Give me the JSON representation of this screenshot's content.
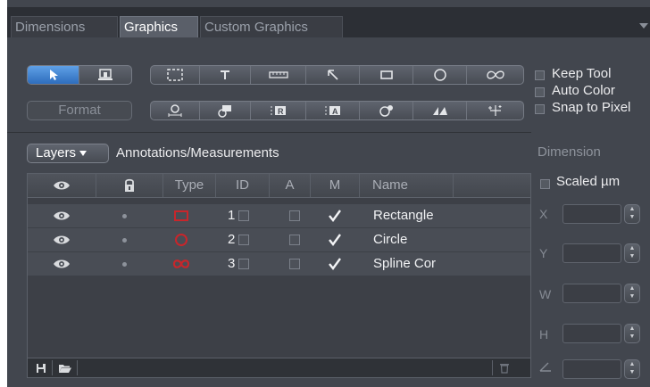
{
  "tabs": [
    {
      "label": "Dimensions",
      "active": false
    },
    {
      "label": "Graphics",
      "active": true
    },
    {
      "label": "Custom Graphics",
      "active": false
    }
  ],
  "toolbar": {
    "format_label": "Format",
    "tool_icons_row1": [
      "arrow-select-icon",
      "stamp-icon",
      "dashed-rect-icon",
      "text-icon",
      "ruler-icon",
      "arrow-line-icon",
      "rectangle-icon",
      "circle-icon",
      "spline-icon"
    ],
    "tool_icons_row2": [
      "scale-bar-icon",
      "color-annot-icon",
      "R-marker-icon",
      "A-marker-icon",
      "events-icon",
      "angle-icon",
      "cross-icon"
    ]
  },
  "options": {
    "keep_tool": "Keep Tool",
    "auto_color": "Auto Color",
    "snap_to_pixel": "Snap to Pixel"
  },
  "layers": {
    "button_label": "Layers",
    "title": "Annotations/Measurements",
    "columns": [
      "Type",
      "ID",
      "A",
      "M",
      "Name"
    ],
    "rows": [
      {
        "id": "1",
        "name": "Rectangle",
        "shape": "rectangle",
        "measured": true
      },
      {
        "id": "2",
        "name": "Circle",
        "shape": "circle",
        "measured": true
      },
      {
        "id": "3",
        "name": "Spline Cor",
        "shape": "spline",
        "measured": true
      }
    ]
  },
  "dimension": {
    "title": "Dimension",
    "scaled_label": "Scaled µm",
    "axes": [
      "X",
      "Y",
      "W",
      "H"
    ]
  },
  "colors": {
    "accent_blue": "#3f84d6",
    "shape_red": "#c8262b",
    "panel_bg": "#42464e"
  }
}
